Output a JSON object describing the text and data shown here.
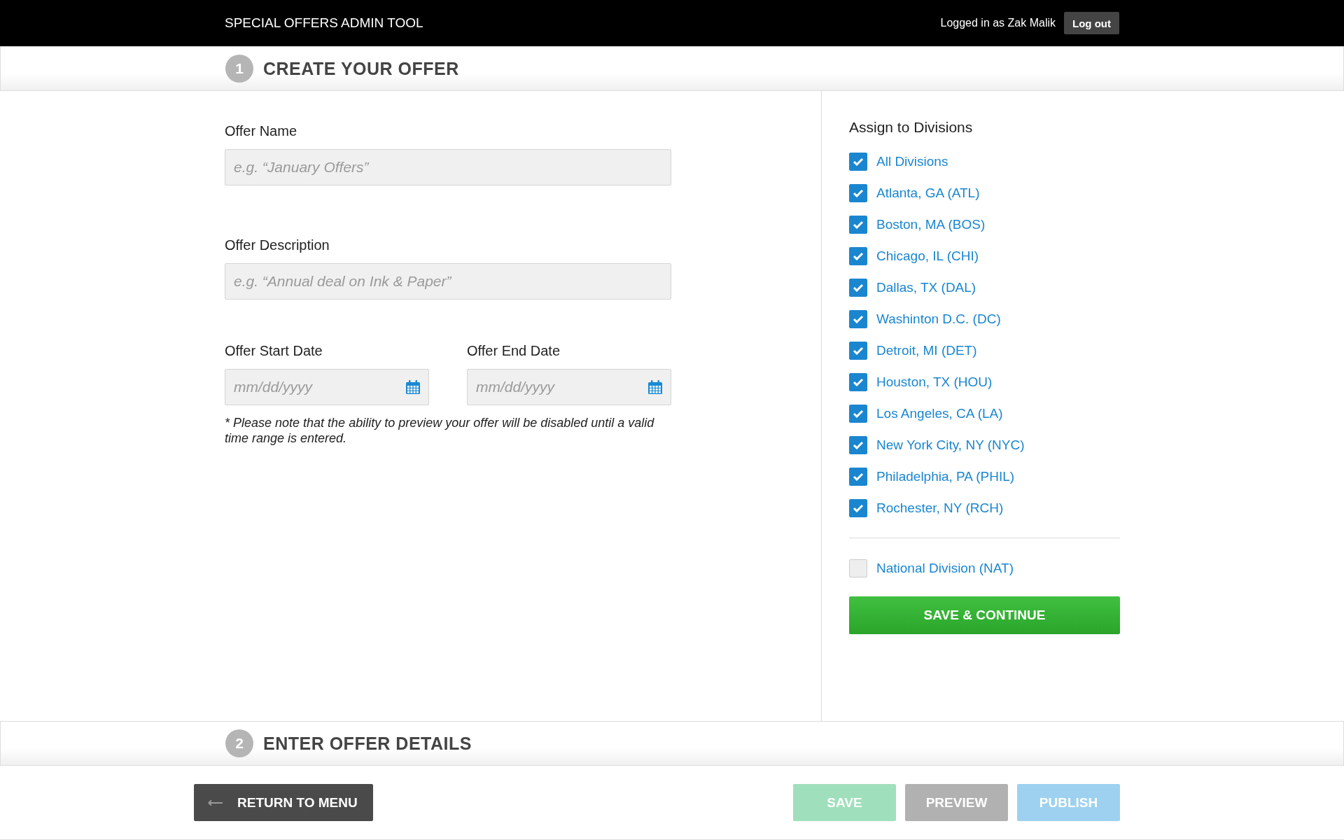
{
  "header": {
    "title": "SPECIAL OFFERS ADMIN TOOL",
    "user_text": "Logged in as Zak Malik",
    "logout": "Log out"
  },
  "steps": [
    {
      "number": "1",
      "title": "CREATE YOUR OFFER"
    },
    {
      "number": "2",
      "title": "ENTER OFFER DETAILS"
    }
  ],
  "form": {
    "offer_name": {
      "label": "Offer Name",
      "placeholder": "e.g. “January Offers”"
    },
    "offer_description": {
      "label": "Offer Description",
      "placeholder": "e.g. “Annual deal on Ink & Paper”"
    },
    "dates": [
      {
        "label": "Offer Start Date",
        "placeholder": "mm/dd/yyyy"
      },
      {
        "label": "Offer End Date",
        "placeholder": "mm/dd/yyyy"
      }
    ],
    "note": "* Please note that the ability to preview your offer will be disabled until a valid time range is entered."
  },
  "divisions": {
    "title": "Assign to Divisions",
    "items": [
      {
        "label": "All Divisions",
        "checked": true
      },
      {
        "label": "Atlanta, GA (ATL)",
        "checked": true
      },
      {
        "label": "Boston, MA (BOS)",
        "checked": true
      },
      {
        "label": "Chicago, IL (CHI)",
        "checked": true
      },
      {
        "label": "Dallas, TX (DAL)",
        "checked": true
      },
      {
        "label": "Washinton D.C. (DC)",
        "checked": true
      },
      {
        "label": "Detroit, MI (DET)",
        "checked": true
      },
      {
        "label": "Houston, TX (HOU)",
        "checked": true
      },
      {
        "label": "Los Angeles, CA (LA)",
        "checked": true
      },
      {
        "label": "New York City, NY (NYC)",
        "checked": true
      },
      {
        "label": "Philadelphia, PA (PHIL)",
        "checked": true
      },
      {
        "label": "Rochester, NY (RCH)",
        "checked": true
      }
    ],
    "extra_items": [
      {
        "label": "National Division (NAT)",
        "checked": false
      }
    ],
    "save_continue": "SAVE & CONTINUE"
  },
  "footer": {
    "return": "RETURN TO MENU",
    "buttons": [
      {
        "label": "SAVE",
        "kind": "save",
        "disabled": true
      },
      {
        "label": "PREVIEW",
        "kind": "preview",
        "disabled": true
      },
      {
        "label": "PUBLISH",
        "kind": "publish",
        "disabled": true
      }
    ]
  }
}
